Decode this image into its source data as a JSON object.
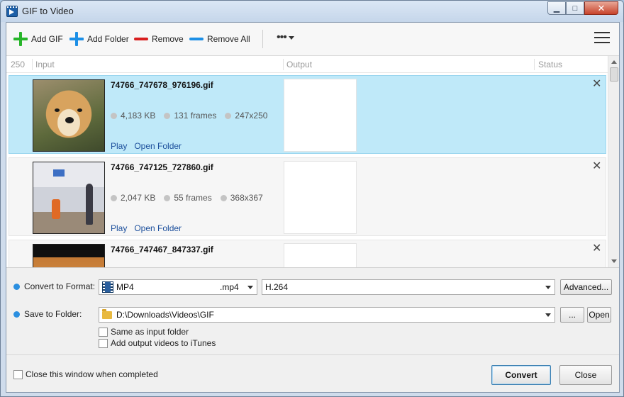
{
  "window": {
    "title": "GIF to Video"
  },
  "toolbar": {
    "add_gif": "Add GIF",
    "add_folder": "Add Folder",
    "remove": "Remove",
    "remove_all": "Remove All",
    "more": "•••"
  },
  "colors": {
    "green": "#27b52a",
    "blue": "#1c8fe6",
    "red": "#d81e1e",
    "accent": "#2b8fe0",
    "selected_row": "#bfe9f9"
  },
  "list": {
    "count": "250",
    "headers": {
      "input": "Input",
      "output": "Output",
      "status": "Status"
    },
    "rows": [
      {
        "name": "74766_747678_976196.gif",
        "size": "4,183 KB",
        "frames": "131 frames",
        "dims": "247x250",
        "play": "Play",
        "open": "Open Folder",
        "selected": true
      },
      {
        "name": "74766_747125_727860.gif",
        "size": "2,047 KB",
        "frames": "55 frames",
        "dims": "368x367",
        "play": "Play",
        "open": "Open Folder",
        "selected": false
      },
      {
        "name": "74766_747467_847337.gif",
        "size": "",
        "frames": "",
        "dims": "",
        "play": "",
        "open": "",
        "selected": false
      }
    ]
  },
  "settings": {
    "format_label": "Convert to Format:",
    "format": "MP4",
    "extension": ".mp4",
    "codec": "H.264",
    "advanced": "Advanced...",
    "folder_label": "Save to Folder:",
    "folder_path": "D:\\Downloads\\Videos\\GIF",
    "browse": "...",
    "open": "Open",
    "same_as_input": "Same as input folder",
    "add_itunes": "Add output videos to iTunes"
  },
  "footer": {
    "close_when_done": "Close this window when completed",
    "convert": "Convert",
    "close": "Close"
  }
}
